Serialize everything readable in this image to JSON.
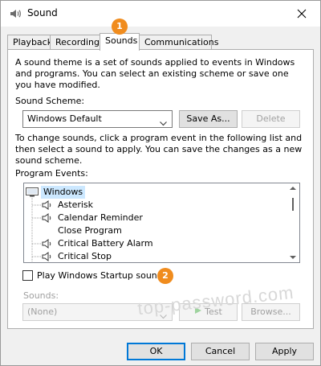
{
  "window": {
    "title": "Sound",
    "icon": "speaker-icon"
  },
  "tabs": [
    {
      "label": "Playback"
    },
    {
      "label": "Recording"
    },
    {
      "label": "Sounds",
      "active": true
    },
    {
      "label": "Communications"
    }
  ],
  "badges": {
    "tab_step": "1",
    "startup_step": "2"
  },
  "description_1": "A sound theme is a set of sounds applied to events in Windows and programs.  You can select an existing scheme or save one you have modified.",
  "sound_scheme": {
    "label": "Sound Scheme:",
    "selected": "Windows Default",
    "save_label": "Save As...",
    "delete_label": "Delete"
  },
  "description_2": "To change sounds, click a program event in the following list and then select a sound to apply.  You can save the changes as a new sound scheme.",
  "program_events": {
    "label": "Program Events:",
    "root": "Windows",
    "items": [
      "Asterisk",
      "Calendar Reminder",
      "Close Program",
      "Critical Battery Alarm",
      "Critical Stop"
    ]
  },
  "startup": {
    "label": "Play Windows Startup sound",
    "checked": false
  },
  "sounds": {
    "label": "Sounds:",
    "selected": "(None)",
    "test_label": "Test",
    "browse_label": "Browse..."
  },
  "watermark": "top-password.com",
  "footer": {
    "ok_label": "OK",
    "cancel_label": "Cancel",
    "apply_label": "Apply"
  },
  "colors": {
    "badge": "#f08c1e",
    "selection": "#cce8ff",
    "accent": "#0078d7"
  }
}
